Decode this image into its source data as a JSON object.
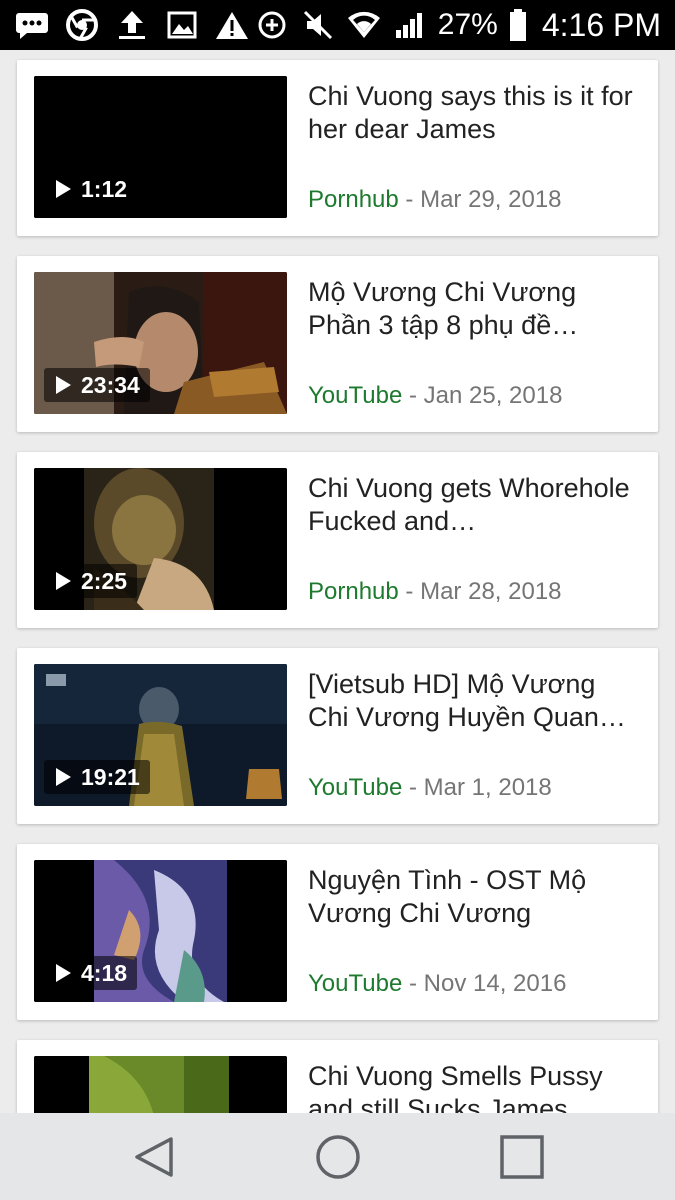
{
  "status_bar": {
    "icons": [
      "messaging-icon",
      "chrome-icon",
      "upload-icon",
      "gallery-icon",
      "warning-icon",
      "data-saver-icon",
      "mute-icon",
      "wifi-icon",
      "signal-icon",
      "battery-icon"
    ],
    "battery": "27%",
    "time": "4:16 PM"
  },
  "results": [
    {
      "title": "Chi Vuong says this is it for her dear James",
      "source": "Pornhub",
      "separator": "-",
      "date": "Mar 29, 2018",
      "duration": "1:12"
    },
    {
      "title": "Mộ Vương Chi Vương Phần 3 tập 8 phụ đề…",
      "source": "YouTube",
      "separator": "-",
      "date": "Jan 25, 2018",
      "duration": "23:34"
    },
    {
      "title": "Chi Vuong gets Whorehole Fucked and…",
      "source": "Pornhub",
      "separator": "-",
      "date": "Mar 28, 2018",
      "duration": "2:25"
    },
    {
      "title": "[Vietsub HD] Mộ Vương Chi Vương Huyền Quan…",
      "source": "YouTube",
      "separator": "-",
      "date": "Mar 1, 2018",
      "duration": "19:21"
    },
    {
      "title": "Nguyện Tình - OST Mộ Vương Chi Vương",
      "source": "YouTube",
      "separator": "-",
      "date": "Nov 14, 2016",
      "duration": "4:18"
    },
    {
      "title": "Chi Vuong Smells Pussy and still Sucks James",
      "source": "",
      "separator": "",
      "date": "",
      "duration": ""
    }
  ],
  "nav_bar": {
    "buttons": [
      "back-icon",
      "home-icon",
      "recents-icon"
    ]
  },
  "colors": {
    "source_green": "#1e7a2e",
    "date_gray": "#757575",
    "nav_bg": "#e5e6e8"
  }
}
